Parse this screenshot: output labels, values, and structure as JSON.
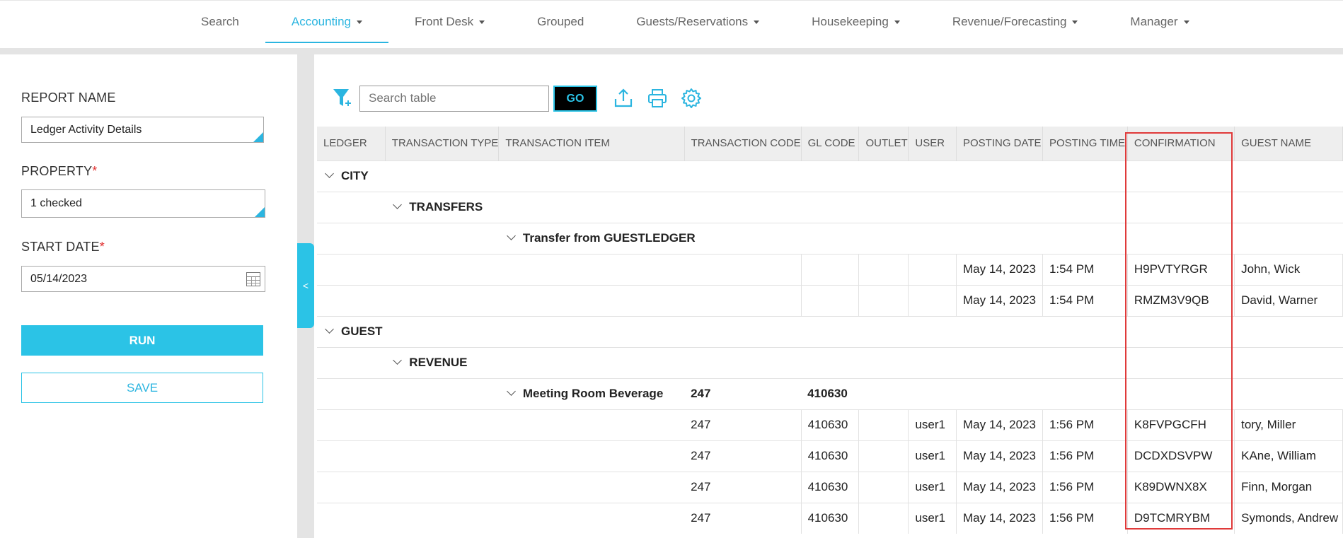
{
  "nav": {
    "items": [
      {
        "label": "Search",
        "dropdown": false,
        "active": false
      },
      {
        "label": "Accounting",
        "dropdown": true,
        "active": true
      },
      {
        "label": "Front Desk",
        "dropdown": true,
        "active": false
      },
      {
        "label": "Grouped",
        "dropdown": false,
        "active": false
      },
      {
        "label": "Guests/Reservations",
        "dropdown": true,
        "active": false
      },
      {
        "label": "Housekeeping",
        "dropdown": true,
        "active": false
      },
      {
        "label": "Revenue/Forecasting",
        "dropdown": true,
        "active": false
      },
      {
        "label": "Manager",
        "dropdown": true,
        "active": false
      }
    ]
  },
  "form": {
    "report_name_label": "REPORT NAME",
    "report_name_value": "Ledger Activity Details",
    "property_label": "PROPERTY",
    "property_value": "1 checked",
    "start_date_label": "START DATE",
    "start_date_value": "05/14/2023",
    "required_mark": "*",
    "run_label": "RUN",
    "save_label": "SAVE",
    "collapse_label": "<"
  },
  "toolbar": {
    "search_placeholder": "Search table",
    "go_label": "GO"
  },
  "colors": {
    "accent": "#2bc3e6",
    "highlight": "#e03a3a"
  },
  "table": {
    "columns": [
      "LEDGER",
      "TRANSACTION TYPE",
      "TRANSACTION ITEM",
      "TRANSACTION CODE",
      "GL CODE",
      "OUTLET",
      "USER",
      "POSTING DATE",
      "POSTING TIME",
      "CONFIRMATION",
      "GUEST NAME"
    ],
    "rows": [
      {
        "kind": "group",
        "level": 0,
        "label": "CITY"
      },
      {
        "kind": "group",
        "level": 1,
        "label": "TRANSFERS"
      },
      {
        "kind": "group",
        "level": 2,
        "label": "Transfer from GUESTLEDGER"
      },
      {
        "kind": "data",
        "cells": [
          "",
          "",
          "",
          "",
          "",
          "",
          "",
          "May 14, 2023",
          "1:54 PM",
          "H9PVTYRGR",
          "John, Wick"
        ]
      },
      {
        "kind": "data",
        "cells": [
          "",
          "",
          "",
          "",
          "",
          "",
          "",
          "May 14, 2023",
          "1:54 PM",
          "RMZM3V9QB",
          "David, Warner"
        ]
      },
      {
        "kind": "group",
        "level": 0,
        "label": "GUEST"
      },
      {
        "kind": "group",
        "level": 1,
        "label": "REVENUE"
      },
      {
        "kind": "group",
        "level": 2,
        "label": "Meeting Room Beverage",
        "code": "247",
        "gl": "410630"
      },
      {
        "kind": "data",
        "cells": [
          "",
          "",
          "",
          "247",
          "410630",
          "",
          "user1",
          "May 14, 2023",
          "1:56 PM",
          "K8FVPGCFH",
          "tory, Miller"
        ]
      },
      {
        "kind": "data",
        "cells": [
          "",
          "",
          "",
          "247",
          "410630",
          "",
          "user1",
          "May 14, 2023",
          "1:56 PM",
          "DCDXDSVPW",
          "KAne, William"
        ]
      },
      {
        "kind": "data",
        "cells": [
          "",
          "",
          "",
          "247",
          "410630",
          "",
          "user1",
          "May 14, 2023",
          "1:56 PM",
          "K89DWNX8X",
          "Finn, Morgan"
        ]
      },
      {
        "kind": "data",
        "cells": [
          "",
          "",
          "",
          "247",
          "410630",
          "",
          "user1",
          "May 14, 2023",
          "1:56 PM",
          "D9TCMRYBM",
          "Symonds, Andrew"
        ]
      }
    ]
  }
}
